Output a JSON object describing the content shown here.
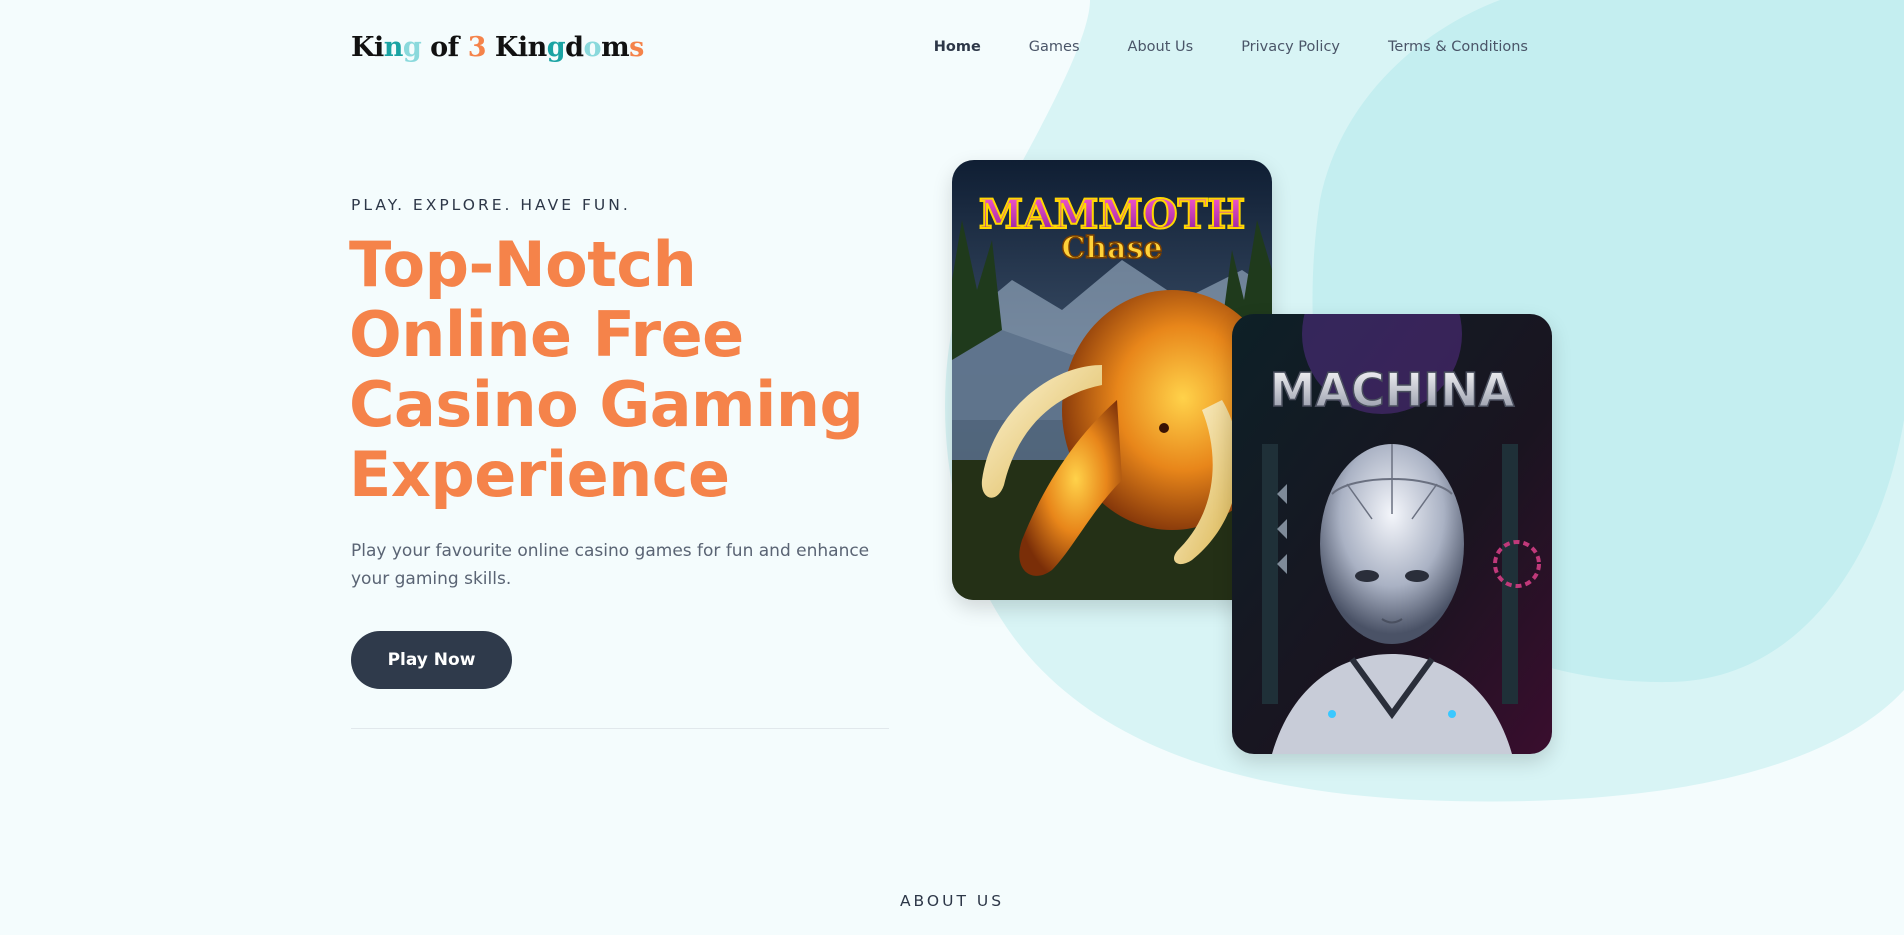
{
  "header": {
    "logo_parts": [
      {
        "text": "Ki",
        "color": "#111111"
      },
      {
        "text": "n",
        "color": "#1aa3a3"
      },
      {
        "text": "g",
        "color": "#8ad9dc"
      },
      {
        "text": " of ",
        "color": "#111111"
      },
      {
        "text": "3",
        "color": "#f5834a"
      },
      {
        "text": " Kin",
        "color": "#111111"
      },
      {
        "text": "g",
        "color": "#1aa3a3"
      },
      {
        "text": "d",
        "color": "#111111"
      },
      {
        "text": "o",
        "color": "#8ad9dc"
      },
      {
        "text": "m",
        "color": "#111111"
      },
      {
        "text": "s",
        "color": "#f5834a"
      }
    ],
    "nav": {
      "home": "Home",
      "games": "Games",
      "about": "About Us",
      "privacy": "Privacy Policy",
      "terms": "Terms & Conditions"
    }
  },
  "hero": {
    "eyebrow": "PLAY. EXPLORE. HAVE FUN.",
    "title_lines": [
      "Top-Notch",
      "Online Free",
      "Casino Gaming",
      "Experience"
    ],
    "subtitle": "Play your favourite online casino games for fun and enhance your gaming skills.",
    "cta_label": "Play Now"
  },
  "games": {
    "mammoth": {
      "title_top": "MAMMOTH",
      "title_bottom": "Chase"
    },
    "machina": {
      "title": "MACHINA"
    }
  },
  "about": {
    "label": "ABOUT US"
  },
  "colors": {
    "accent": "#f5834a",
    "button": "#2f3a4b",
    "background": "#f4fcfd",
    "blob_light": "#d8f4f5",
    "blob_dark": "#c4eef0"
  }
}
